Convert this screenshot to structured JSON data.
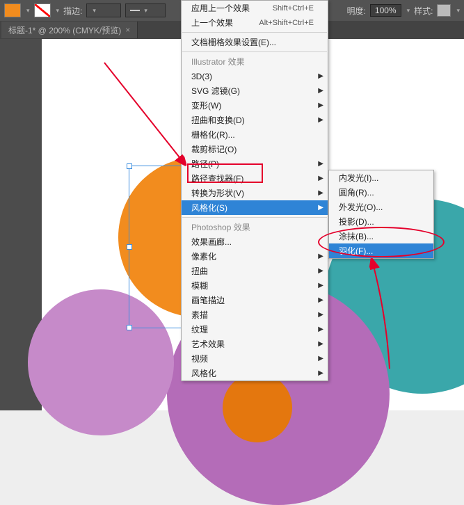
{
  "topbar": {
    "stroke_label": "描边:",
    "stroke_combo": "",
    "brush_combo": "",
    "opacity_label": "明度:",
    "opacity_value": "100%",
    "style_label": "样式:"
  },
  "tab": {
    "title": "标题-1* @ 200% (CMYK/预览)",
    "close": "×"
  },
  "menu_main": {
    "apply_last": "应用上一个效果",
    "apply_last_sc": "Shift+Ctrl+E",
    "last_effect": "上一个效果",
    "last_effect_sc": "Alt+Shift+Ctrl+E",
    "grid_settings": "文档栅格效果设置(E)...",
    "header_ai": "Illustrator 效果",
    "three_d": "3D(3)",
    "svg_filter": "SVG 滤镜(G)",
    "transform": "变形(W)",
    "distort": "扭曲和变换(D)",
    "rasterize": "栅格化(R)...",
    "crop_marks": "裁剪标记(O)",
    "path": "路径(P)",
    "pathfinder": "路径查找器(F)",
    "convert_shape": "转换为形状(V)",
    "stylize_ai": "风格化(S)",
    "header_ps": "Photoshop 效果",
    "fx_gallery": "效果画廊...",
    "pixelate": "像素化",
    "distort_ps": "扭曲",
    "blur": "模糊",
    "brush_strokes": "画笔描边",
    "sketch": "素描",
    "texture": "纹理",
    "artistic": "艺术效果",
    "video": "视频",
    "stylize_ps": "风格化"
  },
  "menu_sub": {
    "inner_glow": "内发光(I)...",
    "round_corners": "圆角(R)...",
    "outer_glow": "外发光(O)...",
    "drop_shadow": "投影(D)...",
    "scribble": "涂抹(B)...",
    "feather": "羽化(F)..."
  }
}
